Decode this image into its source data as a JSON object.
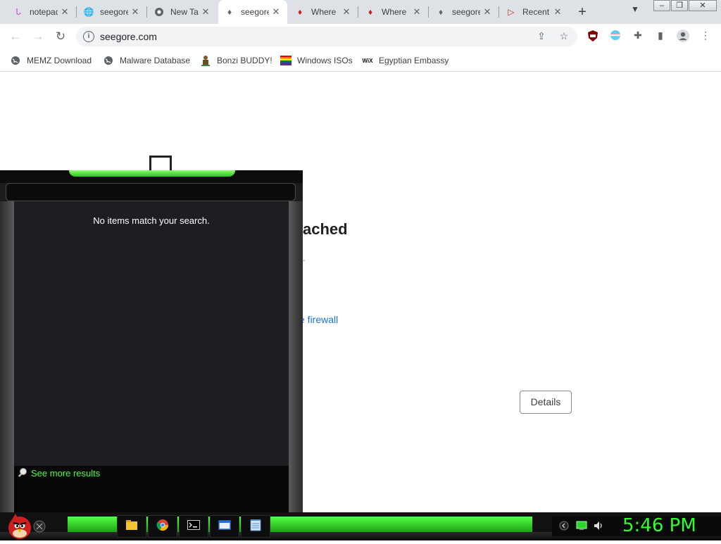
{
  "browser": {
    "tabs": [
      {
        "title": "notepad",
        "favicon": "notepad-favicon",
        "color": "#b25ac8",
        "active": false
      },
      {
        "title": "seegore",
        "favicon": "globe-icon",
        "color": "#5f6368",
        "active": false
      },
      {
        "title": "New Tab",
        "favicon": "chrome-icon",
        "color": "#5f6368",
        "active": false
      },
      {
        "title": "seegore",
        "favicon": "pin-icon",
        "color": "#5f6368",
        "active": true
      },
      {
        "title": "Where",
        "favicon": "pin-icon",
        "color": "#c5221f",
        "active": false
      },
      {
        "title": "Where",
        "favicon": "pin-icon",
        "color": "#c5221f",
        "active": false
      },
      {
        "title": "seegore",
        "favicon": "pin-icon",
        "color": "#5f6368",
        "active": false
      },
      {
        "title": "Recent",
        "favicon": "recent-icon",
        "color": "#c5221f",
        "active": false
      }
    ],
    "new_tab_symbol": "+",
    "url": "seegore.com",
    "bookmarks": [
      {
        "label": "MEMZ Download",
        "icon": "globe-icon"
      },
      {
        "label": "Malware Database",
        "icon": "globe-icon"
      },
      {
        "label": "Bonzi BUDDY!",
        "icon": "bonzi-icon"
      },
      {
        "label": "Windows ISOs",
        "icon": "rainbow-flag-icon"
      },
      {
        "label": "Egyptian Embassy",
        "icon": "wix-icon"
      }
    ]
  },
  "page": {
    "heading_partial": "ached",
    "dot": ".",
    "firewall_link": "e firewall",
    "details_button": "Details"
  },
  "start_menu": {
    "no_items": "No items match your search.",
    "see_more": "See more results"
  },
  "taskbar": {
    "clock": "5:46 PM",
    "accent": "#2cff2c"
  }
}
